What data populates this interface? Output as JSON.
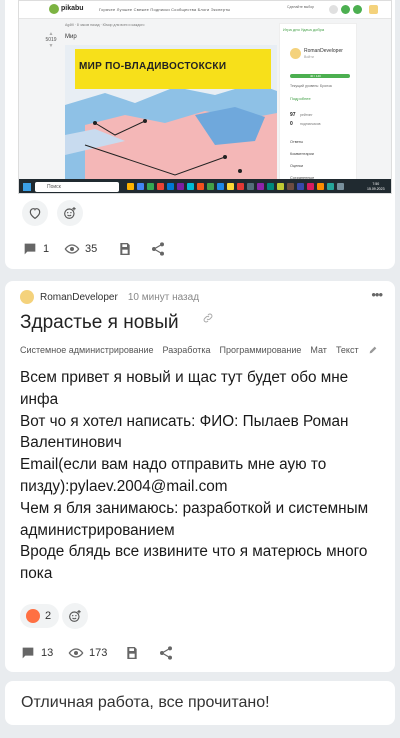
{
  "embed": {
    "site_name": "pikabu",
    "nav": "Горячее  Лучшее  Свежее  Подписки  Сообщества  Блоги  Эксперты",
    "user_status": "Сделайте выбор",
    "rank": "5019",
    "post_meta": "Ag4fil · 8 часов назад   ·   Юмор для всех и каждого",
    "post_title": "Мир",
    "map_banner": "МИР ПО-ВЛАДИВОСТОКСКИ",
    "sidebar": {
      "ad_text": "Игра дня Удача добра",
      "name": "RomanDeveloper",
      "sub": "Войти",
      "progress_label": "40 / 140",
      "level": "Текущий уровень: Бронза",
      "follow": "Подробнее",
      "stat1_value": "97",
      "stat1_label": "рейтинг",
      "stat2_value": "0",
      "stat2_label": "подписчиков",
      "menu": [
        "Ответы",
        "Комментарии",
        "Оценки",
        "Сохраненные"
      ]
    },
    "taskbar": {
      "search": "Поиск",
      "time": "7:50",
      "date": "15.09.2023"
    }
  },
  "prev_post": {
    "comments": "1",
    "views": "35"
  },
  "post": {
    "author": "RomanDeveloper",
    "time": "10 минут назад",
    "more": "•••",
    "title": "Здрастье я новый",
    "tags": [
      "Системное администрирование",
      "Разработка",
      "Программирование",
      "Мат",
      "Текст"
    ],
    "body": [
      "Всем привет я новый и щас тут будет обо мне инфа",
      "Вот чо я хотел написать: ФИО: Пылаев Роман Валентинович",
      "Email(если вам надо отправить мне аую то пизду):pylaev.2004@mail.com",
      "Чем я бля занимаюсь: разработкой и системным администрированием",
      "Вроде блядь все извините что я матерюсь много пока"
    ],
    "reaction_count": "2",
    "comments": "13",
    "views": "173"
  },
  "footer": {
    "text": "Отличная работа, все прочитано!"
  }
}
